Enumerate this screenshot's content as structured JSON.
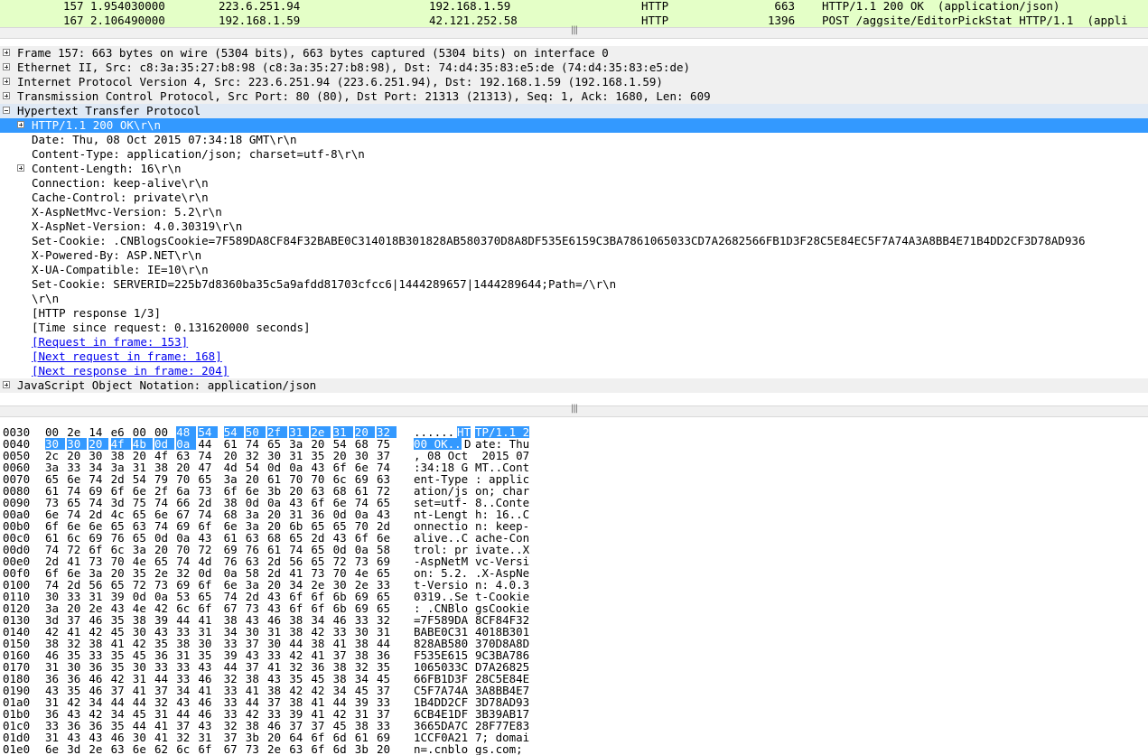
{
  "packet_list": {
    "rows": [
      {
        "no": "157",
        "time": "1.954030000",
        "src": "223.6.251.94",
        "dst": "192.168.1.59",
        "proto": "HTTP",
        "len": "663",
        "info": "HTTP/1.1 200 OK  (application/json)"
      },
      {
        "no": "167",
        "time": "2.106490000",
        "src": "192.168.1.59",
        "dst": "42.121.252.58",
        "proto": "HTTP",
        "len": "1396",
        "info": "POST /aggsite/EditorPickStat HTTP/1.1  (appli"
      }
    ]
  },
  "splitter_glyph": "|||",
  "details": [
    {
      "text": "Frame 157: 663 bytes on wire (5304 bits), 663 bytes captured (5304 bits) on interface 0",
      "expander": "plus"
    },
    {
      "text": "Ethernet II, Src: c8:3a:35:27:b8:98 (c8:3a:35:27:b8:98), Dst: 74:d4:35:83:e5:de (74:d4:35:83:e5:de)",
      "expander": "plus"
    },
    {
      "text": "Internet Protocol Version 4, Src: 223.6.251.94 (223.6.251.94), Dst: 192.168.1.59 (192.168.1.59)",
      "expander": "plus"
    },
    {
      "text": "Transmission Control Protocol, Src Port: 80 (80), Dst Port: 21313 (21313), Seq: 1, Ack: 1680, Len: 609",
      "expander": "plus"
    },
    {
      "text": "Hypertext Transfer Protocol",
      "expander": "minus"
    },
    {
      "text": "HTTP/1.1 200 OK\\r\\n",
      "expander": "plus"
    },
    {
      "text": "Date: Thu, 08 Oct 2015 07:34:18 GMT\\r\\n",
      "expander": ""
    },
    {
      "text": "Content-Type: application/json; charset=utf-8\\r\\n",
      "expander": ""
    },
    {
      "text": "Content-Length: 16\\r\\n",
      "expander": "plus"
    },
    {
      "text": "Connection: keep-alive\\r\\n",
      "expander": ""
    },
    {
      "text": "Cache-Control: private\\r\\n",
      "expander": ""
    },
    {
      "text": "X-AspNetMvc-Version: 5.2\\r\\n",
      "expander": ""
    },
    {
      "text": "X-AspNet-Version: 4.0.30319\\r\\n",
      "expander": ""
    },
    {
      "text": "Set-Cookie: .CNBlogsCookie=7F589DA8CF84F32BABE0C314018B301828AB580370D8A8DF535E6159C3BA7861065033CD7A2682566FB1D3F28C5E84EC5F7A74A3A8BB4E71B4DD2CF3D78AD936",
      "expander": ""
    },
    {
      "text": "X-Powered-By: ASP.NET\\r\\n",
      "expander": ""
    },
    {
      "text": "X-UA-Compatible: IE=10\\r\\n",
      "expander": ""
    },
    {
      "text": "Set-Cookie: SERVERID=225b7d8360ba35c5a9afdd81703cfcc6|1444289657|1444289644;Path=/\\r\\n",
      "expander": ""
    },
    {
      "text": "\\r\\n",
      "expander": ""
    },
    {
      "text": "[HTTP response 1/3]",
      "expander": ""
    },
    {
      "text": "[Time since request: 0.131620000 seconds]",
      "expander": ""
    },
    {
      "text": "[Request in frame: 153]",
      "expander": "",
      "link": true
    },
    {
      "text": "[Next request in frame: 168]",
      "expander": "",
      "link": true
    },
    {
      "text": "[Next response in frame: 204]",
      "expander": "",
      "link": true
    },
    {
      "text": "JavaScript Object Notation: application/json",
      "expander": "plus"
    }
  ],
  "hex": [
    {
      "off": "0030",
      "bytes": [
        "00",
        "2e",
        "14",
        "e6",
        "00",
        "00",
        "48",
        "54",
        "54",
        "50",
        "2f",
        "31",
        "2e",
        "31",
        "20",
        "32"
      ],
      "ascii": "......HTTP/1.1 2"
    },
    {
      "off": "0040",
      "bytes": [
        "30",
        "30",
        "20",
        "4f",
        "4b",
        "0d",
        "0a",
        "44",
        "61",
        "74",
        "65",
        "3a",
        "20",
        "54",
        "68",
        "75"
      ],
      "ascii": "00 OK..Date: Thu"
    },
    {
      "off": "0050",
      "bytes": [
        "2c",
        "20",
        "30",
        "38",
        "20",
        "4f",
        "63",
        "74",
        "20",
        "32",
        "30",
        "31",
        "35",
        "20",
        "30",
        "37"
      ],
      "ascii": ", 08 Oct 2015 07"
    },
    {
      "off": "0060",
      "bytes": [
        "3a",
        "33",
        "34",
        "3a",
        "31",
        "38",
        "20",
        "47",
        "4d",
        "54",
        "0d",
        "0a",
        "43",
        "6f",
        "6e",
        "74"
      ],
      "ascii": ":34:18 GMT..Cont"
    },
    {
      "off": "0070",
      "bytes": [
        "65",
        "6e",
        "74",
        "2d",
        "54",
        "79",
        "70",
        "65",
        "3a",
        "20",
        "61",
        "70",
        "70",
        "6c",
        "69",
        "63"
      ],
      "ascii": "ent-Type: applic"
    },
    {
      "off": "0080",
      "bytes": [
        "61",
        "74",
        "69",
        "6f",
        "6e",
        "2f",
        "6a",
        "73",
        "6f",
        "6e",
        "3b",
        "20",
        "63",
        "68",
        "61",
        "72"
      ],
      "ascii": "ation/json; char"
    },
    {
      "off": "0090",
      "bytes": [
        "73",
        "65",
        "74",
        "3d",
        "75",
        "74",
        "66",
        "2d",
        "38",
        "0d",
        "0a",
        "43",
        "6f",
        "6e",
        "74",
        "65"
      ],
      "ascii": "set=utf-8..Conte"
    },
    {
      "off": "00a0",
      "bytes": [
        "6e",
        "74",
        "2d",
        "4c",
        "65",
        "6e",
        "67",
        "74",
        "68",
        "3a",
        "20",
        "31",
        "36",
        "0d",
        "0a",
        "43"
      ],
      "ascii": "nt-Length: 16..C"
    },
    {
      "off": "00b0",
      "bytes": [
        "6f",
        "6e",
        "6e",
        "65",
        "63",
        "74",
        "69",
        "6f",
        "6e",
        "3a",
        "20",
        "6b",
        "65",
        "65",
        "70",
        "2d"
      ],
      "ascii": "onnection: keep-"
    },
    {
      "off": "00c0",
      "bytes": [
        "61",
        "6c",
        "69",
        "76",
        "65",
        "0d",
        "0a",
        "43",
        "61",
        "63",
        "68",
        "65",
        "2d",
        "43",
        "6f",
        "6e"
      ],
      "ascii": "alive..Cache-Con"
    },
    {
      "off": "00d0",
      "bytes": [
        "74",
        "72",
        "6f",
        "6c",
        "3a",
        "20",
        "70",
        "72",
        "69",
        "76",
        "61",
        "74",
        "65",
        "0d",
        "0a",
        "58"
      ],
      "ascii": "trol: private..X"
    },
    {
      "off": "00e0",
      "bytes": [
        "2d",
        "41",
        "73",
        "70",
        "4e",
        "65",
        "74",
        "4d",
        "76",
        "63",
        "2d",
        "56",
        "65",
        "72",
        "73",
        "69"
      ],
      "ascii": "-AspNetMvc-Versi"
    },
    {
      "off": "00f0",
      "bytes": [
        "6f",
        "6e",
        "3a",
        "20",
        "35",
        "2e",
        "32",
        "0d",
        "0a",
        "58",
        "2d",
        "41",
        "73",
        "70",
        "4e",
        "65"
      ],
      "ascii": "on: 5.2..X-AspNe"
    },
    {
      "off": "0100",
      "bytes": [
        "74",
        "2d",
        "56",
        "65",
        "72",
        "73",
        "69",
        "6f",
        "6e",
        "3a",
        "20",
        "34",
        "2e",
        "30",
        "2e",
        "33"
      ],
      "ascii": "t-Version: 4.0.3"
    },
    {
      "off": "0110",
      "bytes": [
        "30",
        "33",
        "31",
        "39",
        "0d",
        "0a",
        "53",
        "65",
        "74",
        "2d",
        "43",
        "6f",
        "6f",
        "6b",
        "69",
        "65"
      ],
      "ascii": "0319..Set-Cookie"
    },
    {
      "off": "0120",
      "bytes": [
        "3a",
        "20",
        "2e",
        "43",
        "4e",
        "42",
        "6c",
        "6f",
        "67",
        "73",
        "43",
        "6f",
        "6f",
        "6b",
        "69",
        "65"
      ],
      "ascii": ": .CNBlogsCookie"
    },
    {
      "off": "0130",
      "bytes": [
        "3d",
        "37",
        "46",
        "35",
        "38",
        "39",
        "44",
        "41",
        "38",
        "43",
        "46",
        "38",
        "34",
        "46",
        "33",
        "32"
      ],
      "ascii": "=7F589DA8CF84F32"
    },
    {
      "off": "0140",
      "bytes": [
        "42",
        "41",
        "42",
        "45",
        "30",
        "43",
        "33",
        "31",
        "34",
        "30",
        "31",
        "38",
        "42",
        "33",
        "30",
        "31"
      ],
      "ascii": "BABE0C314018B301"
    },
    {
      "off": "0150",
      "bytes": [
        "38",
        "32",
        "38",
        "41",
        "42",
        "35",
        "38",
        "30",
        "33",
        "37",
        "30",
        "44",
        "38",
        "41",
        "38",
        "44"
      ],
      "ascii": "828AB580370D8A8D"
    },
    {
      "off": "0160",
      "bytes": [
        "46",
        "35",
        "33",
        "35",
        "45",
        "36",
        "31",
        "35",
        "39",
        "43",
        "33",
        "42",
        "41",
        "37",
        "38",
        "36"
      ],
      "ascii": "F535E6159C3BA786"
    },
    {
      "off": "0170",
      "bytes": [
        "31",
        "30",
        "36",
        "35",
        "30",
        "33",
        "33",
        "43",
        "44",
        "37",
        "41",
        "32",
        "36",
        "38",
        "32",
        "35"
      ],
      "ascii": "1065033CD7A26825"
    },
    {
      "off": "0180",
      "bytes": [
        "36",
        "36",
        "46",
        "42",
        "31",
        "44",
        "33",
        "46",
        "32",
        "38",
        "43",
        "35",
        "45",
        "38",
        "34",
        "45"
      ],
      "ascii": "66FB1D3F28C5E84E"
    },
    {
      "off": "0190",
      "bytes": [
        "43",
        "35",
        "46",
        "37",
        "41",
        "37",
        "34",
        "41",
        "33",
        "41",
        "38",
        "42",
        "42",
        "34",
        "45",
        "37"
      ],
      "ascii": "C5F7A74A3A8BB4E7"
    },
    {
      "off": "01a0",
      "bytes": [
        "31",
        "42",
        "34",
        "44",
        "44",
        "32",
        "43",
        "46",
        "33",
        "44",
        "37",
        "38",
        "41",
        "44",
        "39",
        "33"
      ],
      "ascii": "1B4DD2CF3D78AD93"
    },
    {
      "off": "01b0",
      "bytes": [
        "36",
        "43",
        "42",
        "34",
        "45",
        "31",
        "44",
        "46",
        "33",
        "42",
        "33",
        "39",
        "41",
        "42",
        "31",
        "37"
      ],
      "ascii": "6CB4E1DF3B39AB17"
    },
    {
      "off": "01c0",
      "bytes": [
        "33",
        "36",
        "36",
        "35",
        "44",
        "41",
        "37",
        "43",
        "32",
        "38",
        "46",
        "37",
        "37",
        "45",
        "38",
        "33"
      ],
      "ascii": "3665DA7C28F77E83"
    },
    {
      "off": "01d0",
      "bytes": [
        "31",
        "43",
        "43",
        "46",
        "30",
        "41",
        "32",
        "31",
        "37",
        "3b",
        "20",
        "64",
        "6f",
        "6d",
        "61",
        "69"
      ],
      "ascii": "1CCF0A217; domai"
    },
    {
      "off": "01e0",
      "bytes": [
        "6e",
        "3d",
        "2e",
        "63",
        "6e",
        "62",
        "6c",
        "6f",
        "67",
        "73",
        "2e",
        "63",
        "6f",
        "6d",
        "3b",
        "20"
      ],
      "ascii": "n=.cnblogs.com; "
    }
  ]
}
